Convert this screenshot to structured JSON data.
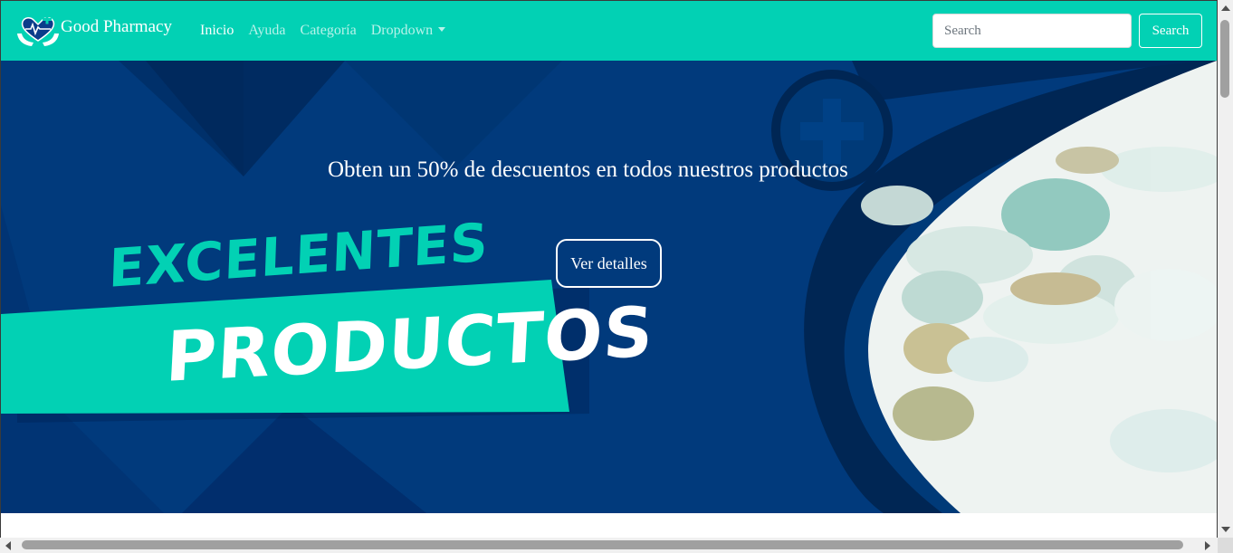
{
  "navbar": {
    "brand_name": "Good Pharmacy",
    "links": [
      {
        "label": "Inicio",
        "active": true
      },
      {
        "label": "Ayuda"
      },
      {
        "label": "Categoría"
      },
      {
        "label": "Dropdown"
      }
    ],
    "search_placeholder": "Search",
    "search_button": "Search"
  },
  "hero": {
    "title": "Obten un 50% de descuentos en todos nuestros productos",
    "button": "Ver detalles",
    "banner_line1": "EXCELENTES",
    "banner_line2": "PRODUCTOS"
  },
  "colors": {
    "navbar": "#02d1b4",
    "hero_bg": "#013a7c",
    "accent": "#02d1b4"
  },
  "icons": [
    "pharmacy-heart-hands-logo",
    "caret-down-icon",
    "medical-cross-icon"
  ]
}
